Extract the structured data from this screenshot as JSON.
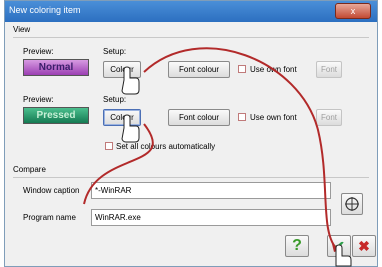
{
  "window": {
    "title": "New coloring item",
    "close_label": "x"
  },
  "view": {
    "section_label": "View",
    "rows": [
      {
        "preview_label": "Preview:",
        "preview_text": "Normal",
        "setup_label": "Setup:",
        "colour_button": "Colour",
        "font_colour_button": "Font colour",
        "use_own_font_label": "Use own font",
        "font_button": "Font"
      },
      {
        "preview_label": "Preview:",
        "preview_text": "Pressed",
        "setup_label": "Setup:",
        "colour_button": "Colour",
        "font_colour_button": "Font colour",
        "use_own_font_label": "Use own font",
        "font_button": "Font"
      }
    ],
    "set_all_label": "Set all colours automatically"
  },
  "compare": {
    "section_label": "Compare",
    "window_caption_label": "Window caption",
    "window_caption_value": "*-WinRAR",
    "program_name_label": "Program name",
    "program_name_value": "WinRAR.exe"
  },
  "footer": {
    "help_symbol": "?",
    "ok_symbol": "✔",
    "cancel_symbol": "✖"
  },
  "colors": {
    "normal_preview_bg": "#b75cc8",
    "normal_preview_text": "#3b1d6b",
    "pressed_preview_bg": "#1f9a6a",
    "pressed_preview_text": "#c7f0d6",
    "annotation_arrow": "#b22a2a"
  },
  "icons": [
    "close-icon",
    "target-icon",
    "help-icon",
    "ok-icon",
    "cancel-icon",
    "hand-cursor-icon"
  ]
}
